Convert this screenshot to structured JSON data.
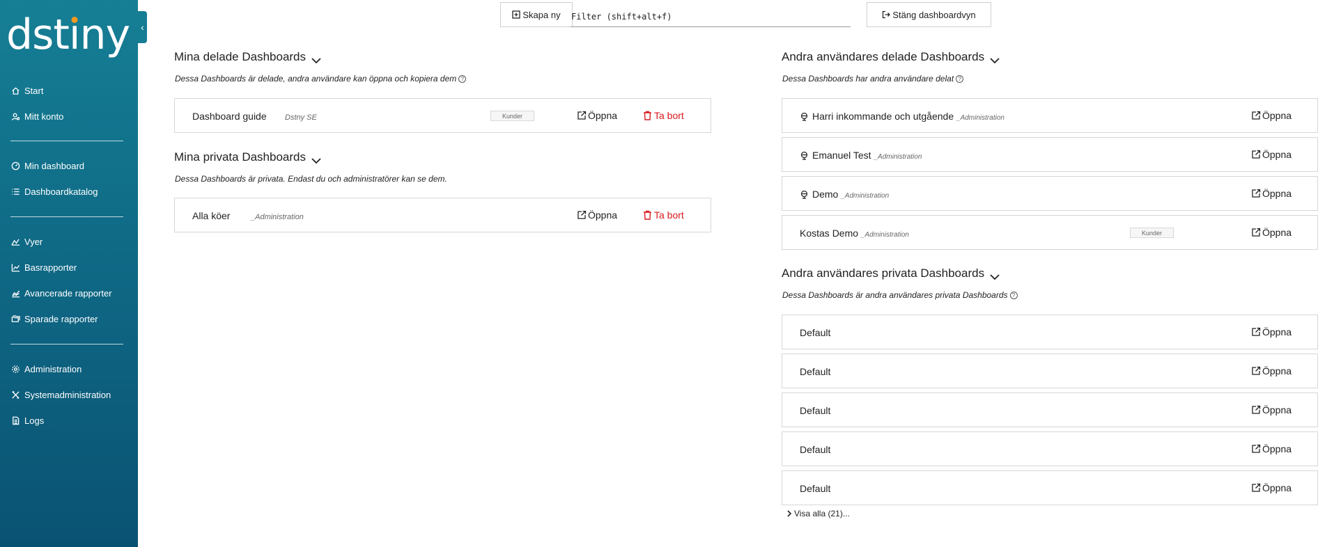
{
  "brand": {
    "logo_text_a": "dst",
    "logo_text_b": "ı",
    "logo_text_c": "ny",
    "accent": "#f29a1f",
    "sidebar_color": "#0f6a86"
  },
  "sidebar": {
    "collapse_icon": "chevron-left-icon",
    "groups": [
      [
        {
          "label": "Start",
          "icon": "home-icon"
        },
        {
          "label": "Mitt konto",
          "icon": "user-icon"
        }
      ],
      [
        {
          "label": "Min dashboard",
          "icon": "gauge-icon"
        },
        {
          "label": "Dashboardkatalog",
          "icon": "list-icon"
        }
      ],
      [
        {
          "label": "Vyer",
          "icon": "chart-area-icon"
        },
        {
          "label": "Basrapporter",
          "icon": "chart-line-icon"
        },
        {
          "label": "Avancerade rapporter",
          "icon": "chart-advanced-icon"
        },
        {
          "label": "Sparade rapporter",
          "icon": "folders-icon"
        }
      ],
      [
        {
          "label": "Administration",
          "icon": "gear-icon"
        },
        {
          "label": "Systemadministration",
          "icon": "tools-icon"
        },
        {
          "label": "Logs",
          "icon": "file-icon"
        }
      ]
    ]
  },
  "toolbar": {
    "create_label": "Skapa ny",
    "filter_placeholder": "Filter (shift+alt+f)",
    "filter_value": "",
    "close_label": "Stäng dashboardvyn"
  },
  "my_shared": {
    "title": "Mina delade Dashboards",
    "desc": "Dessa Dashboards är delade, andra användare kan öppna och kopiera dem",
    "rows": [
      {
        "name": "Dashboard guide",
        "sub": "Dstny SE",
        "badge": "Kunder",
        "open": "Öppna",
        "delete": "Ta bort"
      }
    ]
  },
  "my_private": {
    "title": "Mina privata Dashboards",
    "desc": "Dessa Dashboards är privata. Endast du och administratörer kan se dem.",
    "rows": [
      {
        "name": "Alla köer",
        "sub": "_Administration",
        "open": "Öppna",
        "delete": "Ta bort"
      }
    ]
  },
  "others_shared": {
    "title": "Andra användares delade Dashboards",
    "desc": "Dessa Dashboards har andra användare delat",
    "rows": [
      {
        "name": "Harri inkommande och utgående",
        "tag": "_Administration",
        "open": "Öppna"
      },
      {
        "name": "Emanuel Test",
        "tag": "_Administration",
        "open": "Öppna"
      },
      {
        "name": "Demo",
        "tag": "_Administration",
        "open": "Öppna"
      },
      {
        "name": "Kostas Demo",
        "tag": "_Administration",
        "badge": "Kunder",
        "open": "Öppna"
      }
    ]
  },
  "others_private": {
    "title": "Andra användares privata Dashboards",
    "desc": "Dessa Dashboards är andra användares privata Dashboards",
    "rows": [
      {
        "name": "Default",
        "open": "Öppna"
      },
      {
        "name": "Default",
        "open": "Öppna"
      },
      {
        "name": "Default",
        "open": "Öppna"
      },
      {
        "name": "Default",
        "open": "Öppna"
      },
      {
        "name": "Default",
        "open": "Öppna"
      }
    ],
    "show_all": "Visa alla (21)..."
  }
}
